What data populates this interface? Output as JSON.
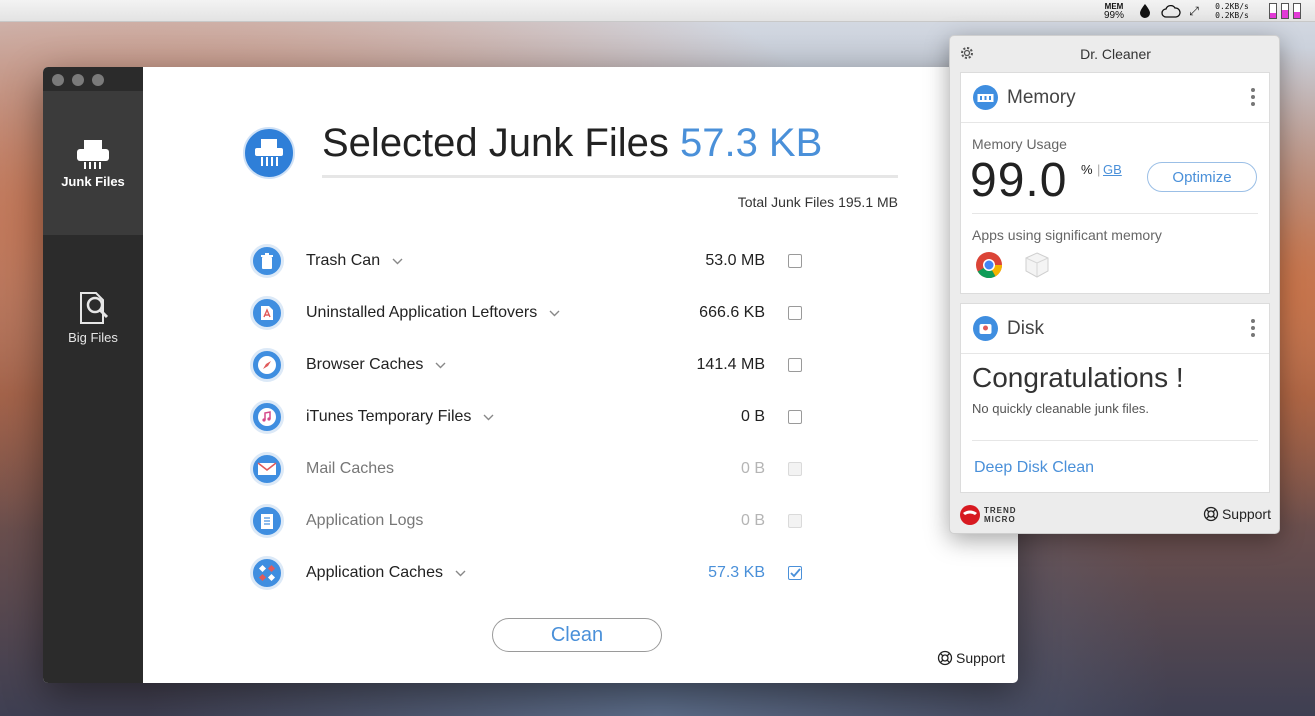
{
  "menubar": {
    "mem_label": "MEM",
    "mem_value": "99%",
    "net_up": "0.2KB/s",
    "net_down": "0.2KB/s",
    "bar_levels": [
      0.35,
      0.6,
      0.4
    ]
  },
  "sidebar": {
    "items": [
      {
        "label": "Junk Files",
        "icon": "shredder-icon",
        "active": true
      },
      {
        "label": "Big Files",
        "icon": "file-search-icon",
        "active": false
      }
    ]
  },
  "main": {
    "title_prefix": "Selected Junk Files",
    "title_size": "57.3 KB",
    "total": "Total Junk Files 195.1 MB",
    "items": [
      {
        "label": "Trash Can",
        "size": "53.0 MB",
        "expandable": true,
        "dim": false,
        "checked": false,
        "icon": "trash-icon",
        "color": "#3f8ee0"
      },
      {
        "label": "Uninstalled Application Leftovers",
        "size": "666.6 KB",
        "expandable": true,
        "dim": false,
        "checked": false,
        "icon": "app-leftovers-icon",
        "color": "#3f8ee0"
      },
      {
        "label": "Browser Caches",
        "size": "141.4 MB",
        "expandable": true,
        "dim": false,
        "checked": false,
        "icon": "safari-icon",
        "color": "#3f8ee0"
      },
      {
        "label": "iTunes Temporary Files",
        "size": "0 B",
        "expandable": true,
        "dim": false,
        "checked": false,
        "icon": "itunes-icon",
        "color": "#3f8ee0"
      },
      {
        "label": "Mail Caches",
        "size": "0 B",
        "expandable": false,
        "dim": true,
        "checked": false,
        "icon": "mail-icon",
        "color": "#3f8ee0"
      },
      {
        "label": "Application Logs",
        "size": "0 B",
        "expandable": false,
        "dim": true,
        "checked": false,
        "icon": "logs-icon",
        "color": "#3f8ee0"
      },
      {
        "label": "Application Caches",
        "size": "57.3 KB",
        "expandable": true,
        "dim": false,
        "checked": true,
        "icon": "app-caches-icon",
        "color": "#3f8ee0"
      }
    ],
    "clean_label": "Clean",
    "support_label": "Support"
  },
  "panel": {
    "title": "Dr. Cleaner",
    "memory": {
      "title": "Memory",
      "usage_label": "Memory Usage",
      "value": "99.0",
      "unit": "%",
      "sep": "|",
      "alt_unit": "GB",
      "optimize_label": "Optimize",
      "apps_label": "Apps using significant memory"
    },
    "disk": {
      "title": "Disk",
      "congrats": "Congratulations !",
      "message": "No quickly cleanable junk files.",
      "deep_clean_label": "Deep Disk Clean"
    },
    "footer": {
      "brand_line1": "TREND",
      "brand_line2": "MICRO",
      "support_label": "Support"
    }
  },
  "colors": {
    "accent": "#4a90d9",
    "sidebar": "#2b2b2b",
    "sidebar_active": "#3b3b3b"
  }
}
